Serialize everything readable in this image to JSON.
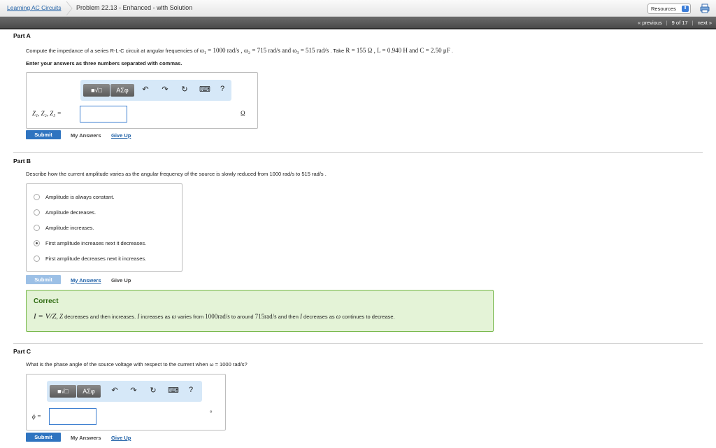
{
  "header": {
    "breadcrumb_course": "Learning AC Circuits",
    "breadcrumb_problem": "Problem 22.13 - Enhanced - with Solution",
    "resources_label": "Resources",
    "pager": {
      "previous": "« previous",
      "position": "9 of 17",
      "next": "next »"
    }
  },
  "partA": {
    "title": "Part A",
    "question_prefix": "Compute the impedance of a series R-L-C circuit at angular frequencies of ",
    "question_math": "ω₁ = 1000 rad/s , ω₂ = 715 rad/s and ω₃ = 515 rad/s",
    "question_mid": " . Take ",
    "question_values": "R = 155 Ω , L = 0.940 H and C = 2.50 μF",
    "question_end": " .",
    "instruction": "Enter your answers as three numbers separated with commas.",
    "toolbar": {
      "template": "■√□",
      "symbols": "ΑΣφ",
      "undo": "↶",
      "redo": "↷",
      "reset": "↻",
      "keyboard": "⌨",
      "help": "?"
    },
    "input_label": "Z₁, Z₂, Z₃ =",
    "input_value": "",
    "unit": "Ω",
    "submit": "Submit",
    "my_answers": "My Answers",
    "give_up": "Give Up"
  },
  "partB": {
    "title": "Part B",
    "question": "Describe how the current amplitude varies as the angular frequency of the source is slowly reduced from 1000 rad/s to 515 rad/s .",
    "options": [
      {
        "label": "Amplitude is always constant.",
        "selected": false
      },
      {
        "label": "Amplitude decreases.",
        "selected": false
      },
      {
        "label": "Amplitude increases.",
        "selected": false
      },
      {
        "label": "First amplitude increases next it decreases.",
        "selected": true
      },
      {
        "label": "First amplitude decreases next it increases.",
        "selected": false
      }
    ],
    "submit": "Submit",
    "my_answers": "My Answers",
    "give_up": "Give Up",
    "feedback": {
      "title": "Correct",
      "formula": "I = V/Z",
      "z_text": ", Z",
      "t1": " decreases and then increases. ",
      "i1": "I",
      "t2": " increases as ",
      "w1": "ω",
      "t3": " varies from ",
      "v1": "1000rad/s",
      "t4": " to around ",
      "v2": "715rad/s",
      "t5": " and then ",
      "i2": "I",
      "t6": " decreases as ",
      "w2": "ω",
      "t7": " continues to decrease."
    }
  },
  "partC": {
    "title": "Part C",
    "question": "What is the phase angle of the source voltage with respect to the current when ω = 1000 rad/s?",
    "toolbar": {
      "template": "■√□",
      "symbols": "ΑΣφ",
      "undo": "↶",
      "redo": "↷",
      "reset": "↻",
      "keyboard": "⌨",
      "help": "?"
    },
    "input_label": "ϕ =",
    "input_value": "",
    "unit": "°",
    "submit": "Submit",
    "my_answers": "My Answers",
    "give_up": "Give Up"
  },
  "colors": {
    "accent": "#2f74c0",
    "correct_bg": "#e4f3d7",
    "correct_border": "#77b84a",
    "toolbar_bg": "#d6e8f8"
  }
}
